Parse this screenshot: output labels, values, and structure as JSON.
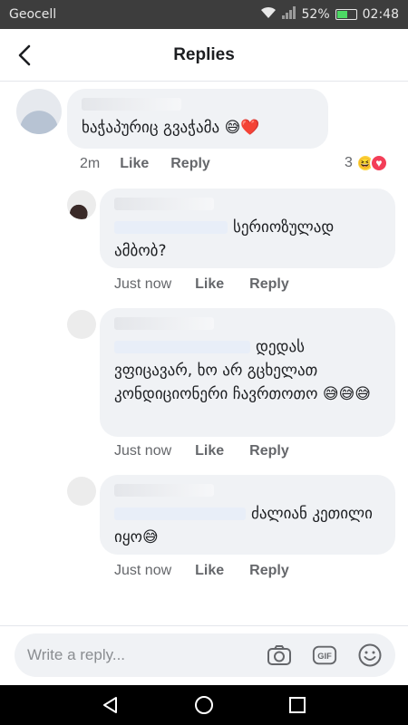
{
  "status_bar": {
    "carrier": "Geocell",
    "battery": "52%",
    "time": "02:48"
  },
  "header": {
    "title": "Replies"
  },
  "main_comment": {
    "text": "ხაჭაპურიც გვაჭამა 😅❤️",
    "time": "2m",
    "like_label": "Like",
    "reply_label": "Reply",
    "reaction_count": "3"
  },
  "replies": [
    {
      "text": "სერიოზულად ამბობ?",
      "time": "Just now",
      "like_label": "Like",
      "reply_label": "Reply"
    },
    {
      "text": "დედას ვფიცავარ, ხო არ გცხელათ კონდიციონერი ჩავრთოთო 😅😅😅",
      "time": "Just now",
      "like_label": "Like",
      "reply_label": "Reply"
    },
    {
      "text": "ძალიან კეთილი იყო😅",
      "time": "Just now",
      "like_label": "Like",
      "reply_label": "Reply"
    }
  ],
  "composer": {
    "placeholder": "Write a reply..."
  },
  "colors": {
    "status_bar": "#3d3d3d",
    "bubble": "#f0f2f5",
    "secondary_text": "#65676b",
    "love": "#f33e58",
    "haha": "#fcd53f"
  },
  "icons": [
    "back-arrow-icon",
    "wifi-icon",
    "signal-icon",
    "battery-icon",
    "camera-icon",
    "gif-icon",
    "emoji-icon",
    "nav-back-icon",
    "nav-home-icon",
    "nav-recents-icon"
  ]
}
